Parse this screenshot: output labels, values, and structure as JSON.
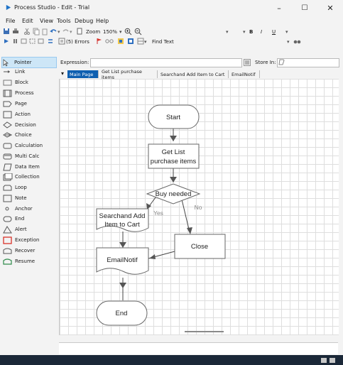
{
  "window": {
    "title": "Process Studio  - Edit - Trial",
    "minimize": "–",
    "maximize": "☐",
    "close": "✕"
  },
  "menu": [
    "File",
    "Edit",
    "View",
    "Tools",
    "Debug",
    "Help"
  ],
  "toolbar1": {
    "zoom_label": "Zoom",
    "zoom_value": "150%",
    "bold": "B",
    "italic": "I",
    "underline": "U"
  },
  "toolbar2": {
    "errors_label": "(5) Errors",
    "find_text_label": "Find Text"
  },
  "palette": [
    {
      "label": "Pointer",
      "icon": "pointer-icon",
      "selected": true
    },
    {
      "label": "Link",
      "icon": "link-icon"
    },
    {
      "label": "Block",
      "icon": "block-icon"
    },
    {
      "label": "Process",
      "icon": "process-icon"
    },
    {
      "label": "Page",
      "icon": "page-icon"
    },
    {
      "label": "Action",
      "icon": "action-icon"
    },
    {
      "label": "Decision",
      "icon": "decision-icon"
    },
    {
      "label": "Choice",
      "icon": "choice-icon"
    },
    {
      "label": "Calculation",
      "icon": "calculation-icon"
    },
    {
      "label": "Multi Calc",
      "icon": "multi-calc-icon"
    },
    {
      "label": "Data Item",
      "icon": "data-item-icon"
    },
    {
      "label": "Collection",
      "icon": "collection-icon"
    },
    {
      "label": "Loop",
      "icon": "loop-icon"
    },
    {
      "label": "Note",
      "icon": "note-icon"
    },
    {
      "label": "Anchor",
      "icon": "anchor-icon"
    },
    {
      "label": "End",
      "icon": "end-icon"
    },
    {
      "label": "Alert",
      "icon": "alert-icon"
    },
    {
      "label": "Exception",
      "icon": "exception-icon"
    },
    {
      "label": "Recover",
      "icon": "recover-icon"
    },
    {
      "label": "Resume",
      "icon": "resume-icon"
    }
  ],
  "expression": {
    "label": "Expression:",
    "value": "",
    "store_label": "Store In:",
    "store_value": ""
  },
  "tabs": [
    {
      "label": "Main Page",
      "active": true
    },
    {
      "label": "Get List purchase items"
    },
    {
      "label": "Searchand Add Item to Cart"
    },
    {
      "label": "EmailNotif"
    }
  ],
  "flow": {
    "start": "Start",
    "get_list": [
      "Get List",
      "purchase items"
    ],
    "decision": "Buy needed",
    "yes": "Yes",
    "no": "No",
    "search_add": [
      "Searchand Add",
      "Item to Cart"
    ],
    "close": "Close",
    "email": "EmailNotif",
    "end": "End"
  },
  "colors": {
    "accent": "#0e5fb0",
    "selected_bg": "#cde6f7",
    "exception": "#d9342b",
    "resume": "#2f8a4a"
  }
}
